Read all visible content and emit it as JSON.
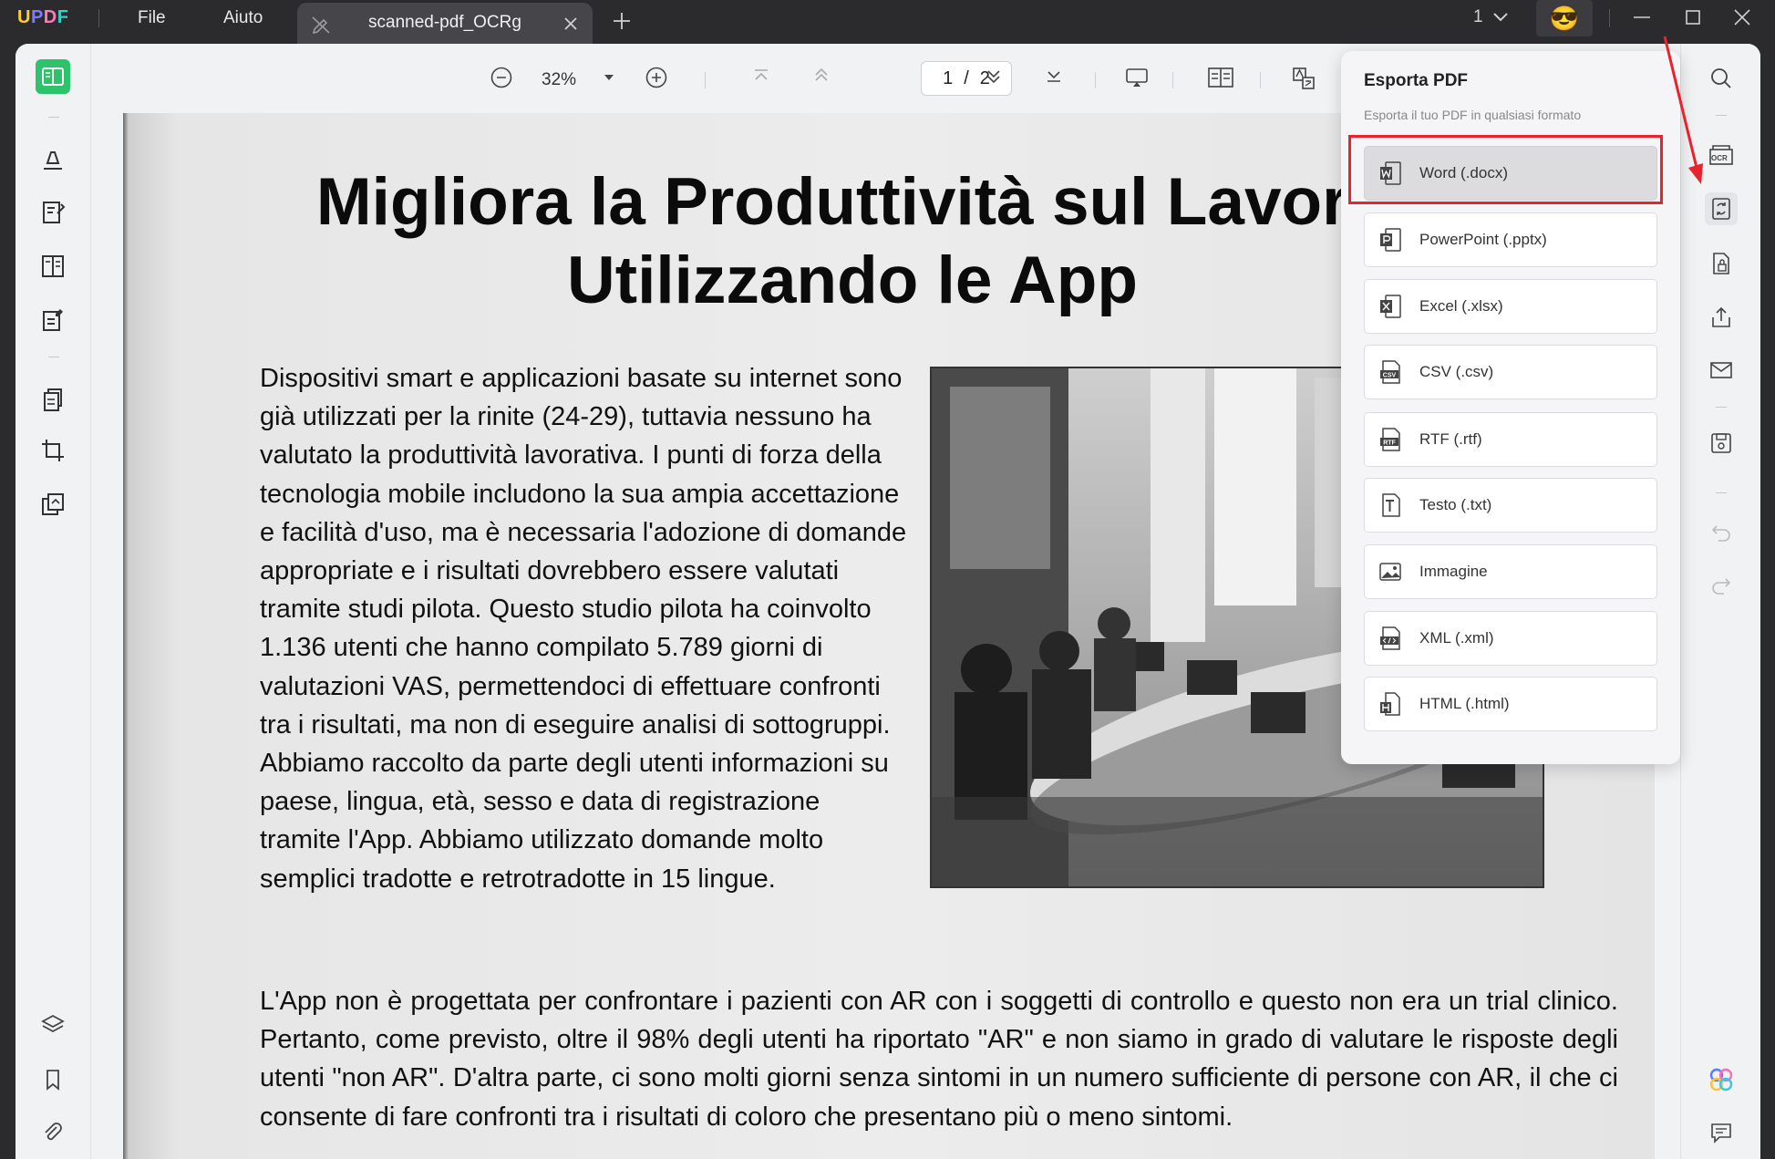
{
  "app": {
    "logo": [
      "U",
      "P",
      "D",
      "F"
    ],
    "menu": [
      {
        "label": "File"
      },
      {
        "label": "Aiuto"
      }
    ]
  },
  "tab": {
    "title": "scanned-pdf_OCRg"
  },
  "titlebar": {
    "page_count": "1",
    "avatar_emoji": "😎"
  },
  "toolbar": {
    "zoom": "32%",
    "current_page": "1",
    "page_separator": "/",
    "total_pages": "2"
  },
  "document": {
    "title": "Migliora la Produttività sul Lavoro Utilizzando le App",
    "paragraph1": "Dispositivi smart e applicazioni basate su internet sono già utilizzati per la rinite (24-29), tuttavia nessuno ha valutato la produttività lavorativa. I punti di forza della tecnologia mobile includono la sua ampia accettazione e facilità d'uso, ma è necessaria l'adozione di domande appropriate e i risultati dovrebbero essere valutati tramite studi pilota. Questo studio pilota ha coinvolto 1.136 utenti che hanno compilato 5.789 giorni di valutazioni VAS, permettendoci di effettuare confronti tra i risultati, ma non di eseguire analisi di sottogruppi. Abbiamo raccolto da parte degli utenti informazioni su paese, lingua, età, sesso e data di registrazione tramite l'App. Abbiamo utilizzato domande molto semplici tradotte e retrotradotte in 15 lingue.",
    "paragraph2": "L'App non è progettata per confrontare i pazienti con AR con i soggetti di controllo e questo non era un trial clinico. Pertanto, come previsto, oltre il 98% degli utenti ha riportato \"AR\" e non siamo in grado di valutare le risposte degli utenti \"non AR\". D'altra parte, ci sono molti giorni senza sintomi in un numero sufficiente di persone con AR, il che ci consente di fare confronti tra i risultati di coloro che presentano più o meno sintomi."
  },
  "export_panel": {
    "title": "Esporta PDF",
    "subtitle": "Esporta il tuo PDF in qualsiasi formato",
    "options": [
      {
        "label": "Word (.docx)",
        "icon": "word-icon",
        "selected": true
      },
      {
        "label": "PowerPoint (.pptx)",
        "icon": "powerpoint-icon"
      },
      {
        "label": "Excel (.xlsx)",
        "icon": "excel-icon"
      },
      {
        "label": "CSV (.csv)",
        "icon": "csv-icon"
      },
      {
        "label": "RTF (.rtf)",
        "icon": "rtf-icon"
      },
      {
        "label": "Testo (.txt)",
        "icon": "text-icon"
      },
      {
        "label": "Immagine",
        "icon": "image-icon"
      },
      {
        "label": "XML (.xml)",
        "icon": "xml-icon"
      },
      {
        "label": "HTML (.html)",
        "icon": "html-icon"
      }
    ],
    "ocr_badge": "OCR"
  },
  "colors": {
    "accent_green": "#2cc36b",
    "highlight_red": "#e8232d",
    "titlebar_bg": "#2b2b2e"
  }
}
